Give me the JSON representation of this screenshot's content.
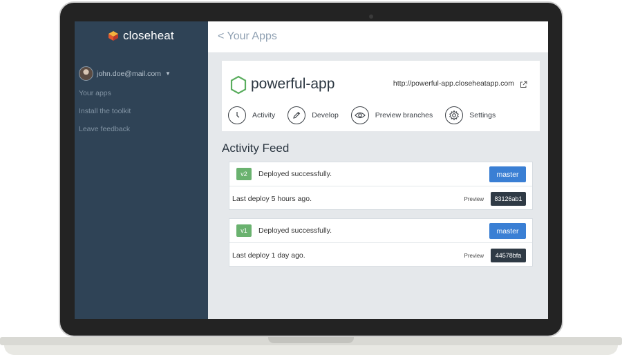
{
  "brand": {
    "name": "closeheat"
  },
  "sidebar": {
    "user_email": "john.doe@mail.com",
    "items": [
      {
        "label": "Your apps"
      },
      {
        "label": "Install the toolkit"
      },
      {
        "label": "Leave feedback"
      }
    ]
  },
  "header": {
    "back_label": "< Your Apps"
  },
  "app": {
    "name": "powerful-app",
    "url": "http://powerful-app.closeheatapp.com",
    "tabs": [
      {
        "label": "Activity",
        "icon": "clock-icon"
      },
      {
        "label": "Develop",
        "icon": "pencil-icon"
      },
      {
        "label": "Preview branches",
        "icon": "eye-icon"
      },
      {
        "label": "Settings",
        "icon": "gear-icon"
      }
    ]
  },
  "feed": {
    "title": "Activity Feed",
    "deploys": [
      {
        "version": "v2",
        "status": "Deployed successfully.",
        "branch": "master",
        "time": "Last deploy 5 hours ago.",
        "preview_label": "Preview",
        "commit": "83126ab1"
      },
      {
        "version": "v1",
        "status": "Deployed successfully.",
        "branch": "master",
        "time": "Last deploy 1 day ago.",
        "preview_label": "Preview",
        "commit": "44578bfa"
      }
    ]
  },
  "colors": {
    "sidebar": "#2f4356",
    "accent": "#3a7fd4",
    "success": "#6ab26f",
    "hexagon": "#5aad5e"
  }
}
